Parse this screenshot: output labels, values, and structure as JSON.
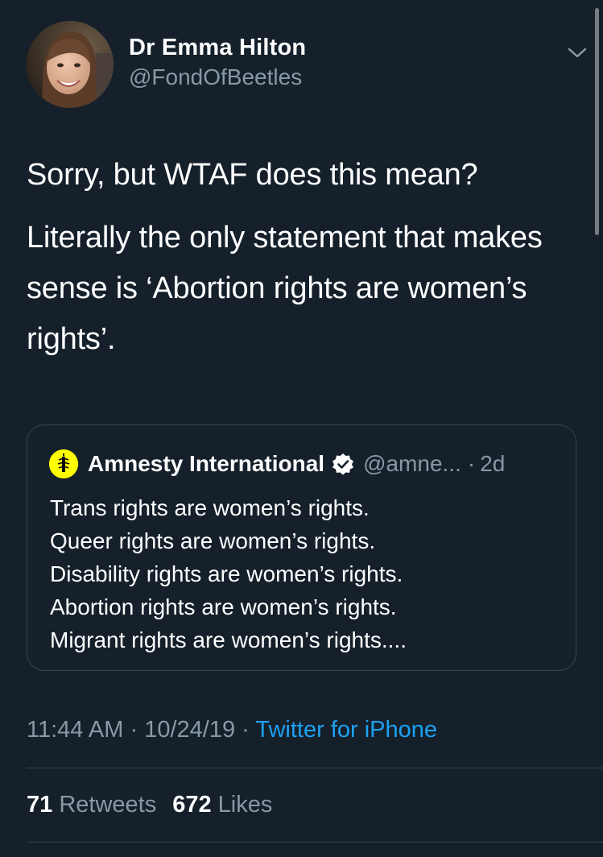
{
  "tweet": {
    "author": {
      "display_name": "Dr Emma Hilton",
      "handle": "@FondOfBeetles",
      "avatar": "avatar-photo"
    },
    "menu_icon": "chevron-down-icon",
    "text": {
      "line1": "Sorry, but WTAF does this mean?",
      "line2": "Literally the only statement that makes sense is ‘Abortion rights are women’s rights’."
    },
    "quote": {
      "logo": "amnesty-candle-icon",
      "name": "Amnesty International",
      "verified_icon": "verified-badge-icon",
      "handle": "@amne...",
      "dot": "·",
      "time": "2d",
      "lines": [
        "Trans rights are women’s rights.",
        "Queer rights are women’s rights.",
        "Disability rights are women’s rights.",
        "Abortion rights are women’s rights.",
        "Migrant rights are women’s rights...."
      ]
    },
    "meta": {
      "time": "11:44 AM",
      "sep1": "·",
      "date": "10/24/19",
      "sep2": "·",
      "source": "Twitter for iPhone"
    },
    "stats": {
      "retweets_count": "71",
      "retweets_label": "Retweets",
      "likes_count": "672",
      "likes_label": "Likes"
    }
  },
  "colors": {
    "background": "#15202b",
    "text": "#ffffff",
    "secondary": "#8899a6",
    "link": "#1da1f2",
    "border": "#38444d",
    "amnesty_yellow": "#ffff00"
  }
}
